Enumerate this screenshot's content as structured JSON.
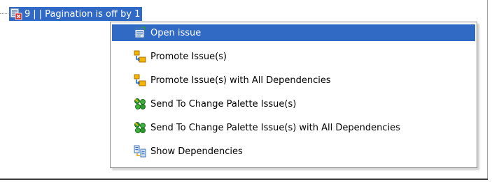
{
  "tree": {
    "issue_number": "9",
    "separator": "|",
    "issue_title": "| Pagination is off by 1",
    "row_icon": "issue-error-icon"
  },
  "context_menu": {
    "items": [
      {
        "label": "Open issue",
        "icon": "open-issue-icon",
        "active": true
      },
      {
        "label": "Promote Issue(s)",
        "icon": "promote-icon",
        "active": false
      },
      {
        "label": "Promote Issue(s) with All Dependencies",
        "icon": "promote-dependencies-icon",
        "active": false
      },
      {
        "label": "Send To Change Palette Issue(s)",
        "icon": "change-palette-icon",
        "active": false
      },
      {
        "label": "Send To Change Palette Issue(s) with All Dependencies",
        "icon": "change-palette-dependencies-icon",
        "active": false
      },
      {
        "label": "Show Dependencies",
        "icon": "show-dependencies-icon",
        "active": false
      }
    ]
  },
  "colors": {
    "selection": "#316ac5",
    "tree_selection": "#3169c6",
    "menu_border": "#8d8d8d"
  }
}
